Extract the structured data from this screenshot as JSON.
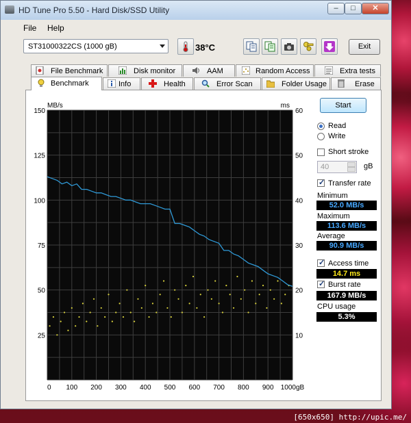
{
  "window": {
    "title": "HD Tune Pro 5.50 - Hard Disk/SSD Utility",
    "controls": {
      "minimize": "–",
      "maximize": "□",
      "close": "✕"
    }
  },
  "menu": {
    "file": "File",
    "help": "Help"
  },
  "toolbar": {
    "drive": "ST31000322CS (1000 gB)",
    "temperature": "38°C",
    "exit_label": "Exit"
  },
  "tabs_row1": [
    "File Benchmark",
    "Disk monitor",
    "AAM",
    "Random Access",
    "Extra tests"
  ],
  "tabs_row2": [
    "Benchmark",
    "Info",
    "Health",
    "Error Scan",
    "Folder Usage",
    "Erase"
  ],
  "active_tab": "Benchmark",
  "controls": {
    "start_label": "Start",
    "read_label": "Read",
    "write_label": "Write",
    "mode": "Read",
    "short_stroke_label": "Short stroke",
    "short_stroke_checked": false,
    "short_stroke_value": "40",
    "short_stroke_unit": "gB",
    "transfer_rate_label": "Transfer rate",
    "transfer_rate_checked": true,
    "minimum_label": "Minimum",
    "minimum_value": "52.0 MB/s",
    "maximum_label": "Maximum",
    "maximum_value": "113.6 MB/s",
    "average_label": "Average",
    "average_value": "90.9 MB/s",
    "access_time_label": "Access time",
    "access_time_checked": true,
    "access_time_value": "14.7 ms",
    "burst_rate_label": "Burst rate",
    "burst_rate_checked": true,
    "burst_rate_value": "167.9 MB/s",
    "cpu_usage_label": "CPU usage",
    "cpu_usage_value": "5.3%"
  },
  "chart_data": {
    "type": "line",
    "left_axis_label": "MB/s",
    "right_axis_label": "ms",
    "x_unit": "gB",
    "x_ticks": [
      "0",
      "100",
      "200",
      "300",
      "400",
      "500",
      "600",
      "700",
      "800",
      "900",
      "1000gB"
    ],
    "left_ticks": [
      "150",
      "125",
      "100",
      "75",
      "50",
      "25"
    ],
    "right_ticks": [
      "60",
      "50",
      "40",
      "30",
      "20",
      "10"
    ],
    "xlim": [
      0,
      1000
    ],
    "ylim_left": [
      0,
      150
    ],
    "ylim_right": [
      0,
      60
    ],
    "grid": true,
    "series": [
      {
        "name": "Transfer rate",
        "axis": "left",
        "color": "#2f9ad8",
        "x": [
          0,
          20,
          40,
          60,
          80,
          100,
          120,
          140,
          160,
          180,
          200,
          220,
          240,
          260,
          280,
          300,
          320,
          340,
          360,
          380,
          400,
          420,
          440,
          460,
          480,
          500,
          520,
          540,
          560,
          580,
          600,
          620,
          640,
          660,
          680,
          700,
          720,
          740,
          760,
          780,
          800,
          820,
          840,
          860,
          880,
          900,
          920,
          940,
          960,
          980,
          1000
        ],
        "y": [
          113,
          112,
          111,
          109,
          110,
          108,
          109,
          106,
          106,
          105,
          104,
          104,
          103,
          102,
          102,
          101,
          100,
          100,
          99,
          98,
          98,
          98,
          97,
          96,
          95,
          95,
          87,
          87,
          86,
          85,
          83,
          81,
          80,
          78,
          77,
          76,
          72,
          72,
          70,
          69,
          67,
          65,
          64,
          63,
          61,
          59,
          58,
          57,
          55,
          53,
          52
        ]
      },
      {
        "name": "Access time",
        "axis": "right",
        "color": "#d8d13c",
        "type": "scatter",
        "x": [
          10,
          25,
          40,
          55,
          70,
          85,
          100,
          115,
          130,
          145,
          160,
          175,
          190,
          205,
          220,
          235,
          250,
          265,
          280,
          295,
          310,
          325,
          340,
          355,
          370,
          385,
          400,
          415,
          430,
          445,
          460,
          475,
          490,
          505,
          520,
          535,
          550,
          565,
          580,
          595,
          610,
          625,
          640,
          655,
          670,
          685,
          700,
          715,
          730,
          745,
          760,
          775,
          790,
          805,
          820,
          835,
          850,
          865,
          880,
          895,
          910,
          925,
          940,
          955,
          970,
          985
        ],
        "y": [
          12,
          14,
          10,
          13,
          15,
          11,
          16,
          12,
          14,
          17,
          13,
          15,
          18,
          12,
          16,
          14,
          19,
          13,
          15,
          17,
          14,
          20,
          15,
          13,
          18,
          16,
          21,
          14,
          17,
          15,
          19,
          22,
          16,
          14,
          20,
          18,
          15,
          21,
          17,
          23,
          16,
          19,
          14,
          20,
          18,
          22,
          17,
          15,
          21,
          19,
          16,
          23,
          18,
          20,
          15,
          22,
          17,
          19,
          21,
          16,
          20,
          18,
          22,
          17,
          19,
          21
        ]
      }
    ]
  },
  "watermark": "[650x650] http://upic.me/"
}
